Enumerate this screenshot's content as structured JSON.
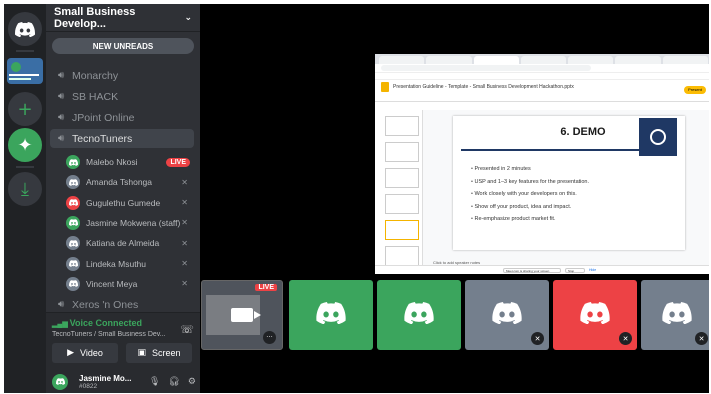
{
  "server": {
    "name": "Small Business Develop..."
  },
  "new_unreads": "NEW UNREADS",
  "channels": [
    {
      "name": "Monarchy"
    },
    {
      "name": "SB HACK"
    },
    {
      "name": "JPoint Online"
    },
    {
      "name": "TecnoTuners",
      "selected": true
    },
    {
      "name": "Xeros 'n Ones"
    }
  ],
  "members": [
    {
      "name": "Malebo Nkosi",
      "live": "LIVE",
      "color": "#3ba55d"
    },
    {
      "name": "Amanda Tshonga",
      "color": "#747f8d"
    },
    {
      "name": "Gugulethu Gumede",
      "color": "#ed4245"
    },
    {
      "name": "Jasmine Mokwena (staff)",
      "color": "#3ba55d"
    },
    {
      "name": "Katiana de Almeida",
      "color": "#747f8d"
    },
    {
      "name": "Lindeka Msuthu",
      "color": "#747f8d"
    },
    {
      "name": "Vincent Meya",
      "color": "#747f8d"
    }
  ],
  "voice": {
    "status": "Voice Connected",
    "location": "TecnoTuners / Small Business Dev...",
    "video_label": "Video",
    "screen_label": "Screen"
  },
  "current_user": {
    "name": "Jasmine Mo...",
    "tag": "#0822"
  },
  "stream": {
    "doc_title": "Presentation Guideline - Template - Small Business Development Hackathon.pptx",
    "present_label": "Present",
    "slide_title": "6. DEMO",
    "bullets": [
      "Presented in 2 minutes",
      "USP and 1–3 key features for the presentation.",
      "Work closely with your developers on this.",
      "Show off your product, idea and impact.",
      "Re-emphasize product market fit."
    ],
    "speaker_notes": "Click to add speaker notes",
    "share_bar": "Meet.com is sharing your screen",
    "stop_sharing": "Stop sharing",
    "hide": "Hide"
  },
  "tiles": [
    {
      "type": "preview",
      "live": "LIVE",
      "color": "#4f545c"
    },
    {
      "type": "avatar",
      "color": "#3ba55d"
    },
    {
      "type": "avatar",
      "color": "#3ba55d"
    },
    {
      "type": "avatar",
      "color": "#747f8d",
      "muted": true
    },
    {
      "type": "avatar",
      "color": "#ed4245",
      "muted": true
    },
    {
      "type": "avatar",
      "color": "#747f8d",
      "muted": true
    }
  ],
  "colors": {
    "green": "#3ba55d",
    "red": "#ed4245",
    "grey": "#747f8d",
    "blurple": "#5865f2"
  }
}
